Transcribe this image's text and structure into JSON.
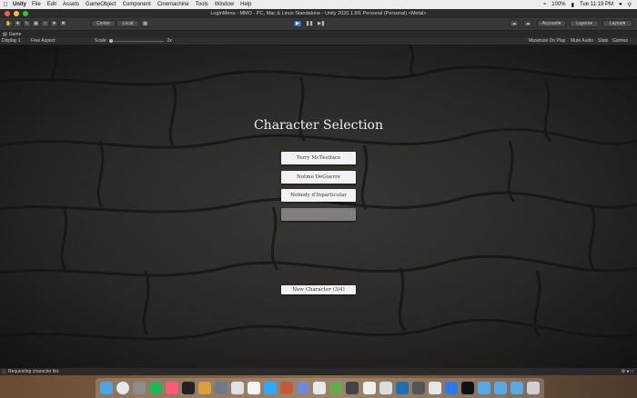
{
  "menubar": {
    "app": "Unity",
    "items": [
      "File",
      "Edit",
      "Assets",
      "GameObject",
      "Component",
      "Cinemachine",
      "Tools",
      "Window",
      "Help"
    ],
    "battery": "100%",
    "clock": "Tue 11:19 PM"
  },
  "window": {
    "title": "LoginMenu - MMO - PC, Mac & Linux Standalone - Unity 2020.1.9f1 Personal (Personal) <Metal>"
  },
  "toolbar": {
    "pivot": "Center",
    "space": "Local",
    "account": "Account",
    "layers": "Layers",
    "layout": "Layout"
  },
  "game_tab": {
    "label": "Game"
  },
  "game_controls": {
    "display": "Display 1",
    "aspect": "Free Aspect",
    "scale_label": "Scale",
    "scale_value": "2x",
    "maximize": "Maximize On Play",
    "mute": "Mute Audio",
    "stats": "Stats",
    "gizmos": "Gizmos"
  },
  "screen": {
    "title": "Character Selection",
    "characters": [
      "Terry McTestface",
      "Notme DeGuerre",
      "Nobody d'Inparticular",
      ""
    ],
    "new_character": "New Character (3/4)"
  },
  "status": {
    "message": "Requesting character list."
  },
  "colors": {
    "button": "#f2f2f2",
    "empty_slot": "#7f7f7f",
    "play_active": "#3c75c8"
  }
}
